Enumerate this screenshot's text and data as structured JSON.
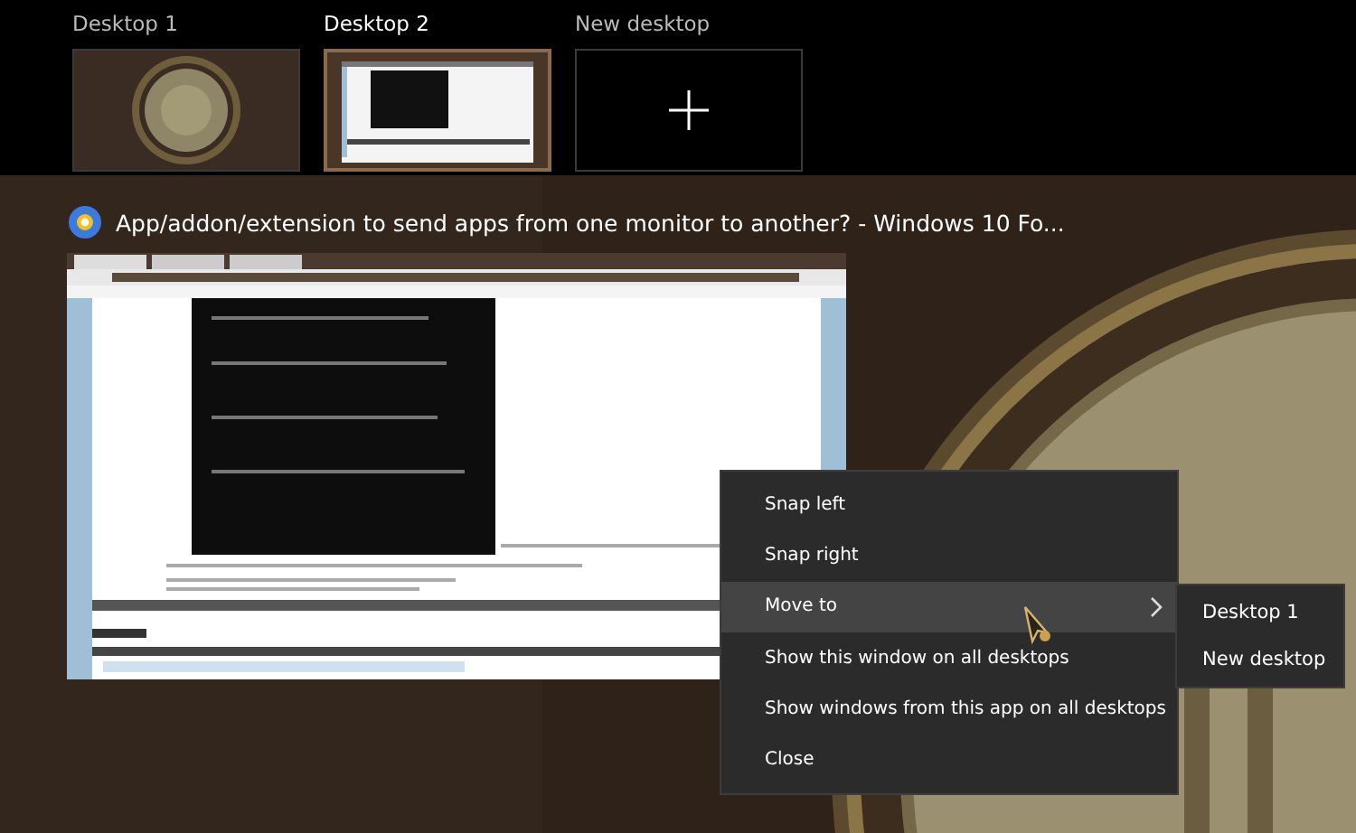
{
  "desktops": [
    {
      "label": "Desktop 1",
      "kind": "desktop",
      "selected": false
    },
    {
      "label": "Desktop 2",
      "kind": "desktop",
      "selected": true
    },
    {
      "label": "New desktop",
      "kind": "new",
      "selected": false
    }
  ],
  "window": {
    "title": "App/addon/extension to send apps from one monitor to another? - Windows 10 Fo..."
  },
  "context_menu": {
    "items": [
      {
        "label": "Snap left",
        "kind": "action",
        "selected": false
      },
      {
        "label": "Snap right",
        "kind": "action",
        "selected": false
      },
      {
        "label": "Move to",
        "kind": "submenu",
        "selected": true
      },
      {
        "label": "Show this window on all desktops",
        "kind": "action",
        "selected": false
      },
      {
        "label": "Show windows from this app on all desktops",
        "kind": "action",
        "selected": false
      },
      {
        "label": "Close",
        "kind": "action",
        "selected": false
      }
    ]
  },
  "submenu": {
    "items": [
      {
        "label": "Desktop 1",
        "selected": false
      },
      {
        "label": "New desktop",
        "selected": false
      }
    ]
  }
}
